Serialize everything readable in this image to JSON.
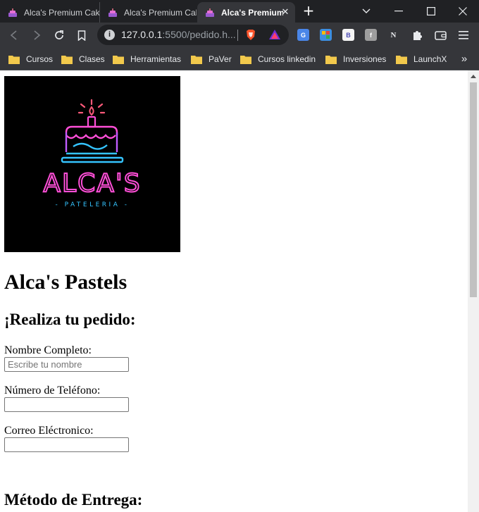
{
  "browser": {
    "tabs": [
      {
        "title": "Alca's Premium Cakes",
        "active": false
      },
      {
        "title": "Alca's Premium Cakes",
        "active": false
      },
      {
        "title": "Alca's Premium Cakes",
        "active": true
      }
    ],
    "address": {
      "host": "127.0.0.1",
      "path": ":5500/pedido.h..."
    },
    "extensions": [
      "google-translate-icon",
      "extension-icon",
      "bold-b-icon",
      "feedly-icon",
      "notion-icon",
      "puzzle-icon",
      "wallet-icon"
    ],
    "bookmarks": [
      "Cursos",
      "Clases",
      "Herramientas",
      "PaVer",
      "Cursos linkedin",
      "Inversiones",
      "LaunchX"
    ],
    "bookmarks_more": "»",
    "colors": {
      "tabstrip": "#202124",
      "toolbar": "#35363a",
      "folder": "#f2c94c"
    }
  },
  "page": {
    "logo": {
      "brand": "ALCA'S",
      "tagline": "- PATELERIA -",
      "colors": {
        "neon_pink": "#ff4fd8",
        "neon_blue": "#35c4ff",
        "candle_flame": "#ff5a7a"
      }
    },
    "title": "Alca's Pastels",
    "order_heading": "¡Realiza tu pedido:",
    "form": {
      "name_label": "Nombre Completo:",
      "name_placeholder": "Escribe tu nombre",
      "phone_label": "Número de Teléfono:",
      "email_label": "Correo Eléctronico:"
    },
    "delivery_heading": "Método de Entrega:"
  }
}
